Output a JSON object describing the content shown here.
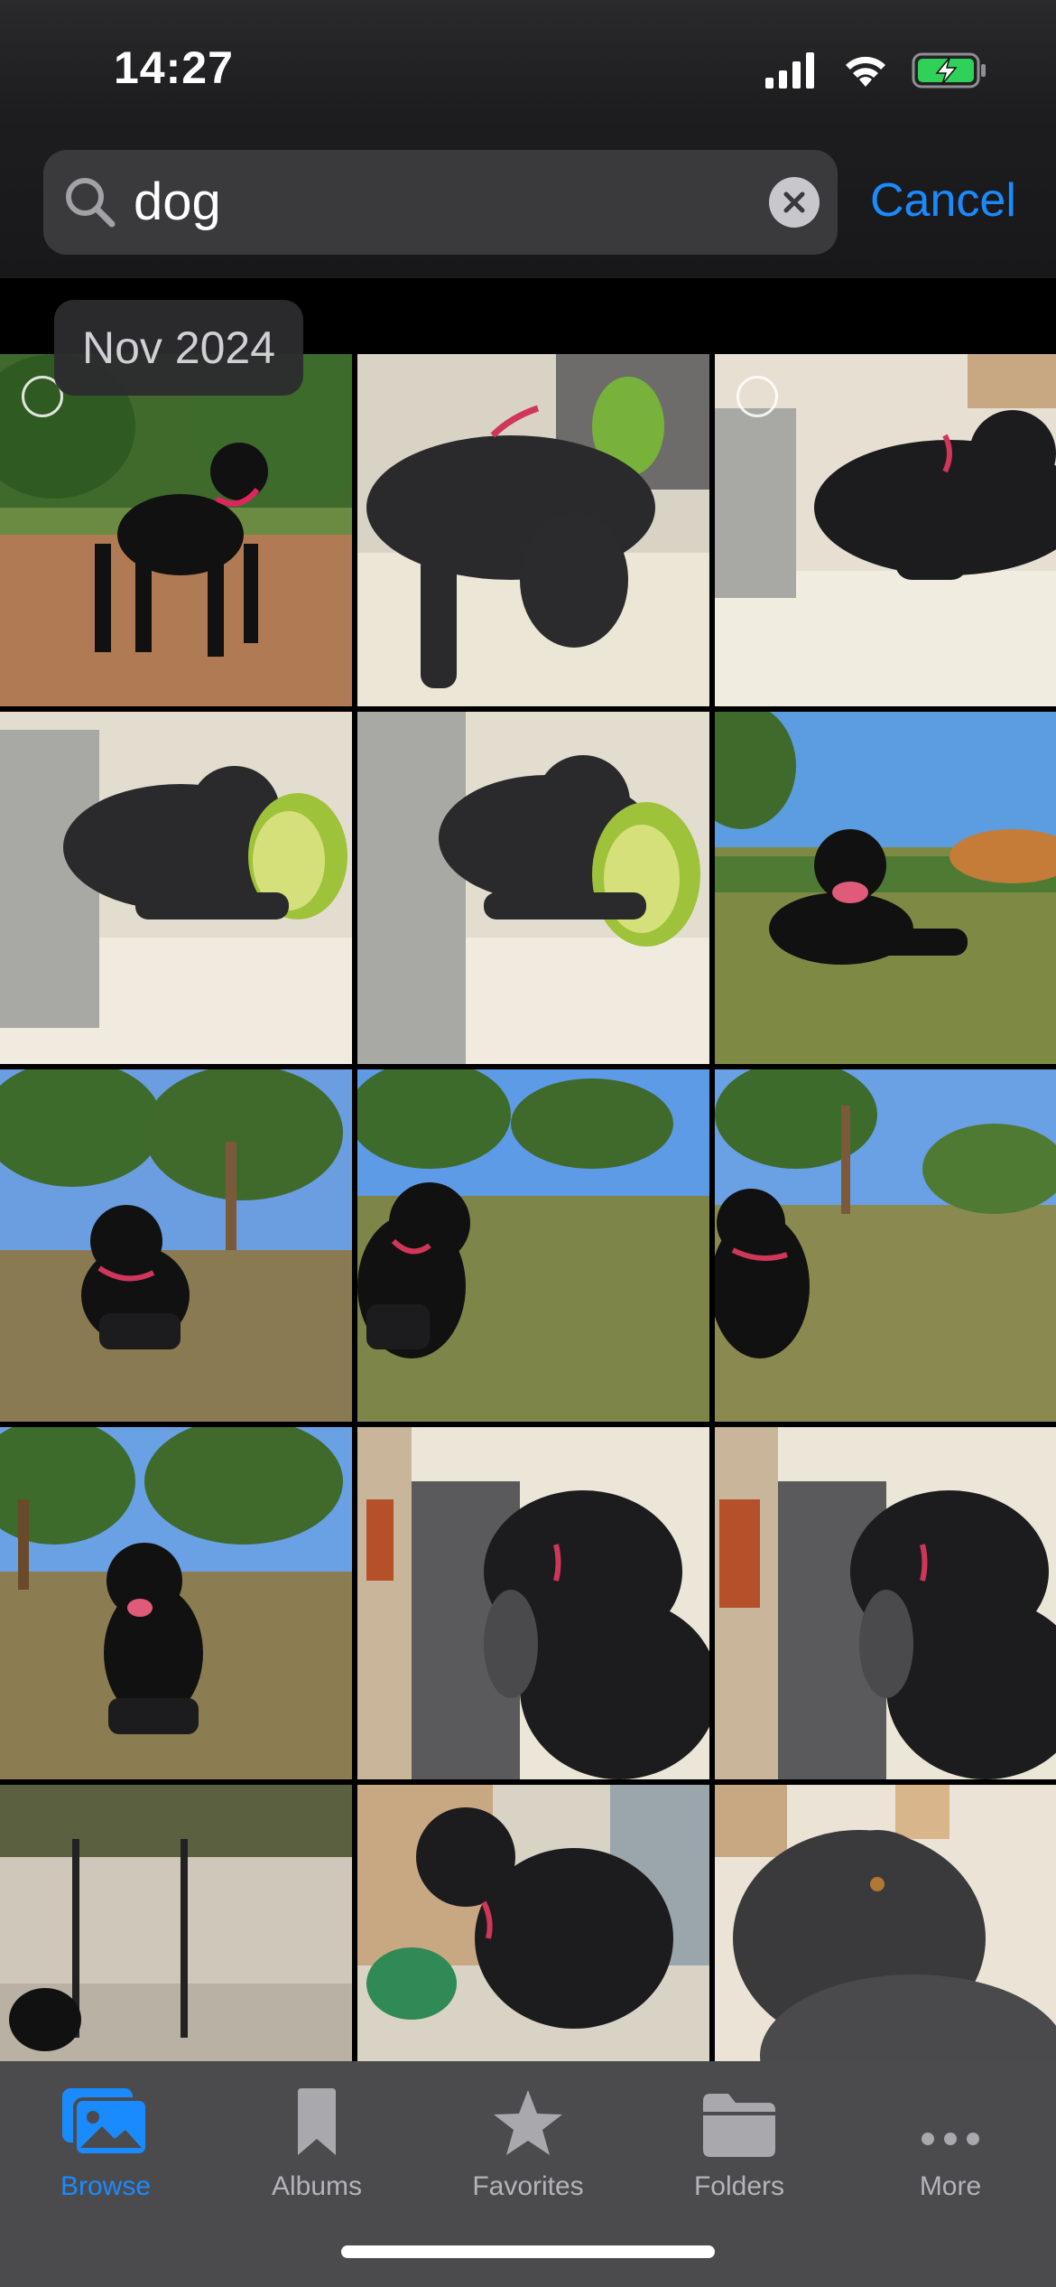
{
  "status_bar": {
    "time": "14:27",
    "battery_color": "#30d158"
  },
  "search": {
    "query": "dog",
    "cancel_label": "Cancel"
  },
  "grid": {
    "section_date": "Nov 2024"
  },
  "tabs": [
    {
      "label": "Browse",
      "icon": "photos-icon",
      "active": true
    },
    {
      "label": "Albums",
      "icon": "bookmark-icon",
      "active": false
    },
    {
      "label": "Favorites",
      "icon": "star-icon",
      "active": false
    },
    {
      "label": "Folders",
      "icon": "folder-icon",
      "active": false
    },
    {
      "label": "More",
      "icon": "ellipsis-icon",
      "active": false
    }
  ],
  "colors": {
    "accent": "#1a8bff",
    "tab_bar": "#4b4b4d"
  }
}
